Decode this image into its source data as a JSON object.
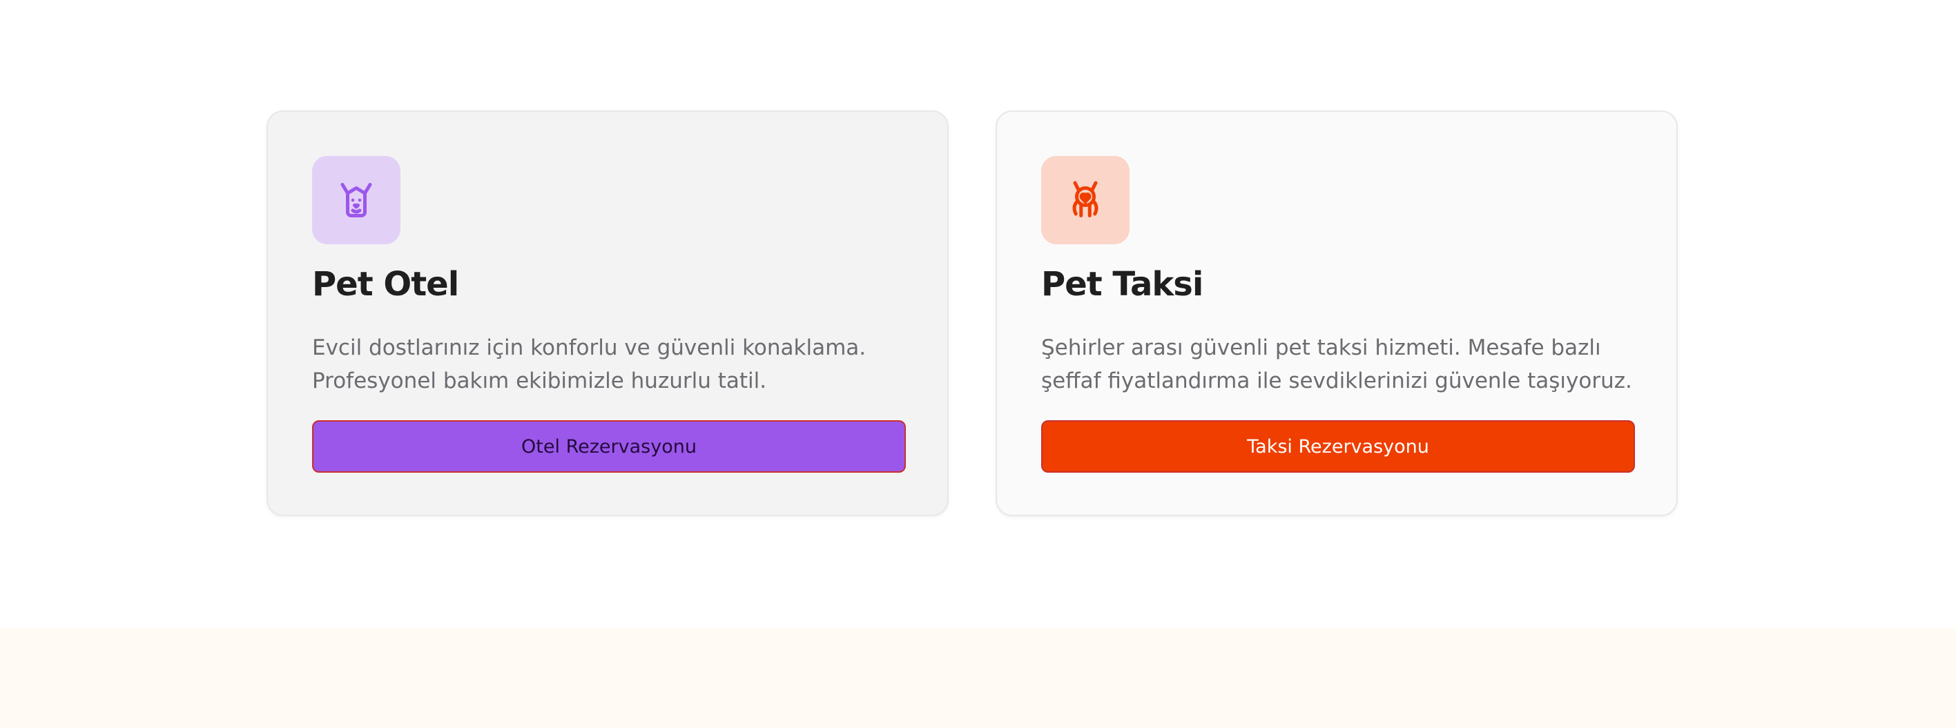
{
  "colors": {
    "hotel_accent": "#9b57ea",
    "hotel_icon_bg": "#e3d0f7",
    "taxi_accent": "#ef3e00",
    "taxi_icon_bg": "#fbd5c8"
  },
  "cards": [
    {
      "icon": "dog-icon",
      "title": "Pet Otel",
      "description": "Evcil dostlarınız için konforlu ve güvenli konaklama. Profesyonel bakım ekibimizle huzurlu tatil.",
      "button_label": "Otel Rezervasyonu"
    },
    {
      "icon": "cat-heart-icon",
      "title": "Pet Taksi",
      "description": "Şehirler arası güvenli pet taksi hizmeti. Mesafe bazlı şeffaf fiyatlandırma ile sevdiklerinizi güvenle taşıyoruz.",
      "button_label": "Taksi Rezervasyonu"
    }
  ]
}
